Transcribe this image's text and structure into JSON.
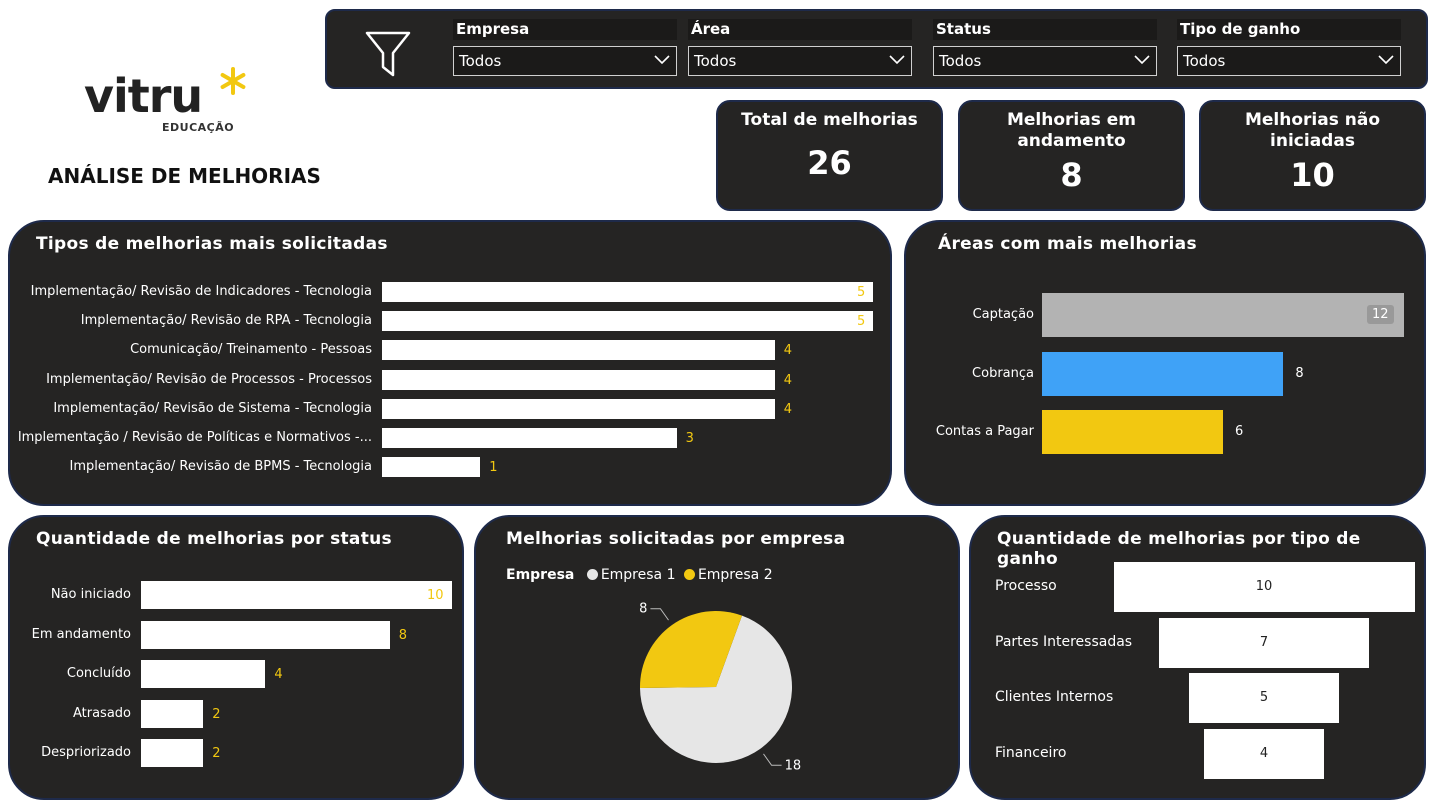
{
  "filters": [
    {
      "label": "Empresa",
      "value": "Todos"
    },
    {
      "label": "Área",
      "value": "Todos"
    },
    {
      "label": "Status",
      "value": "Todos"
    },
    {
      "label": "Tipo de ganho",
      "value": "Todos"
    }
  ],
  "logo": {
    "word": "vitru",
    "sub": "EDUCAÇÃO",
    "star_color": "#f2c811"
  },
  "page_title": "ANÁLISE DE MELHORIAS",
  "kpis": [
    {
      "title": "Total de melhorias",
      "value": "26"
    },
    {
      "title": "Melhorias em andamento",
      "value": "8"
    },
    {
      "title": "Melhorias não iniciadas",
      "value": "10"
    }
  ],
  "chart_data": [
    {
      "type": "bar",
      "title": "Tipos de melhorias mais solicitadas",
      "categories": [
        "Implementação/ Revisão de Indicadores - Tecnologia",
        "Implementação/ Revisão de RPA - Tecnologia",
        "Comunicação/ Treinamento - Pessoas",
        "Implementação/ Revisão de Processos - Processos",
        "Implementação/ Revisão de Sistema - Tecnologia",
        "Implementação / Revisão de Políticas e Normativos -...",
        "Implementação/ Revisão de BPMS - Tecnologia"
      ],
      "values": [
        5,
        5,
        4,
        4,
        4,
        3,
        1
      ],
      "orientation": "horizontal"
    },
    {
      "type": "bar",
      "title": "Áreas com mais melhorias",
      "categories": [
        "Captação",
        "Cobrança",
        "Contas a Pagar"
      ],
      "values": [
        12,
        8,
        6
      ],
      "colors": [
        "#b3b3b3",
        "#3fa2f7",
        "#f2c811"
      ],
      "orientation": "horizontal"
    },
    {
      "type": "bar",
      "title": "Quantidade de melhorias por status",
      "categories": [
        "Não iniciado",
        "Em andamento",
        "Concluído",
        "Atrasado",
        "Despriorizado"
      ],
      "values": [
        10,
        8,
        4,
        2,
        2
      ],
      "orientation": "horizontal"
    },
    {
      "type": "pie",
      "title": "Melhorias solicitadas por empresa",
      "legend_title": "Empresa",
      "series": [
        {
          "name": "Empresa 1",
          "value": 18,
          "color": "#e6e6e6"
        },
        {
          "name": "Empresa 2",
          "value": 8,
          "color": "#f2c811"
        }
      ]
    },
    {
      "type": "funnel",
      "title": "Quantidade de melhorias por tipo de ganho",
      "categories": [
        "Processo",
        "Partes Interessadas",
        "Clientes Internos",
        "Financeiro"
      ],
      "values": [
        10,
        7,
        5,
        4
      ]
    }
  ]
}
